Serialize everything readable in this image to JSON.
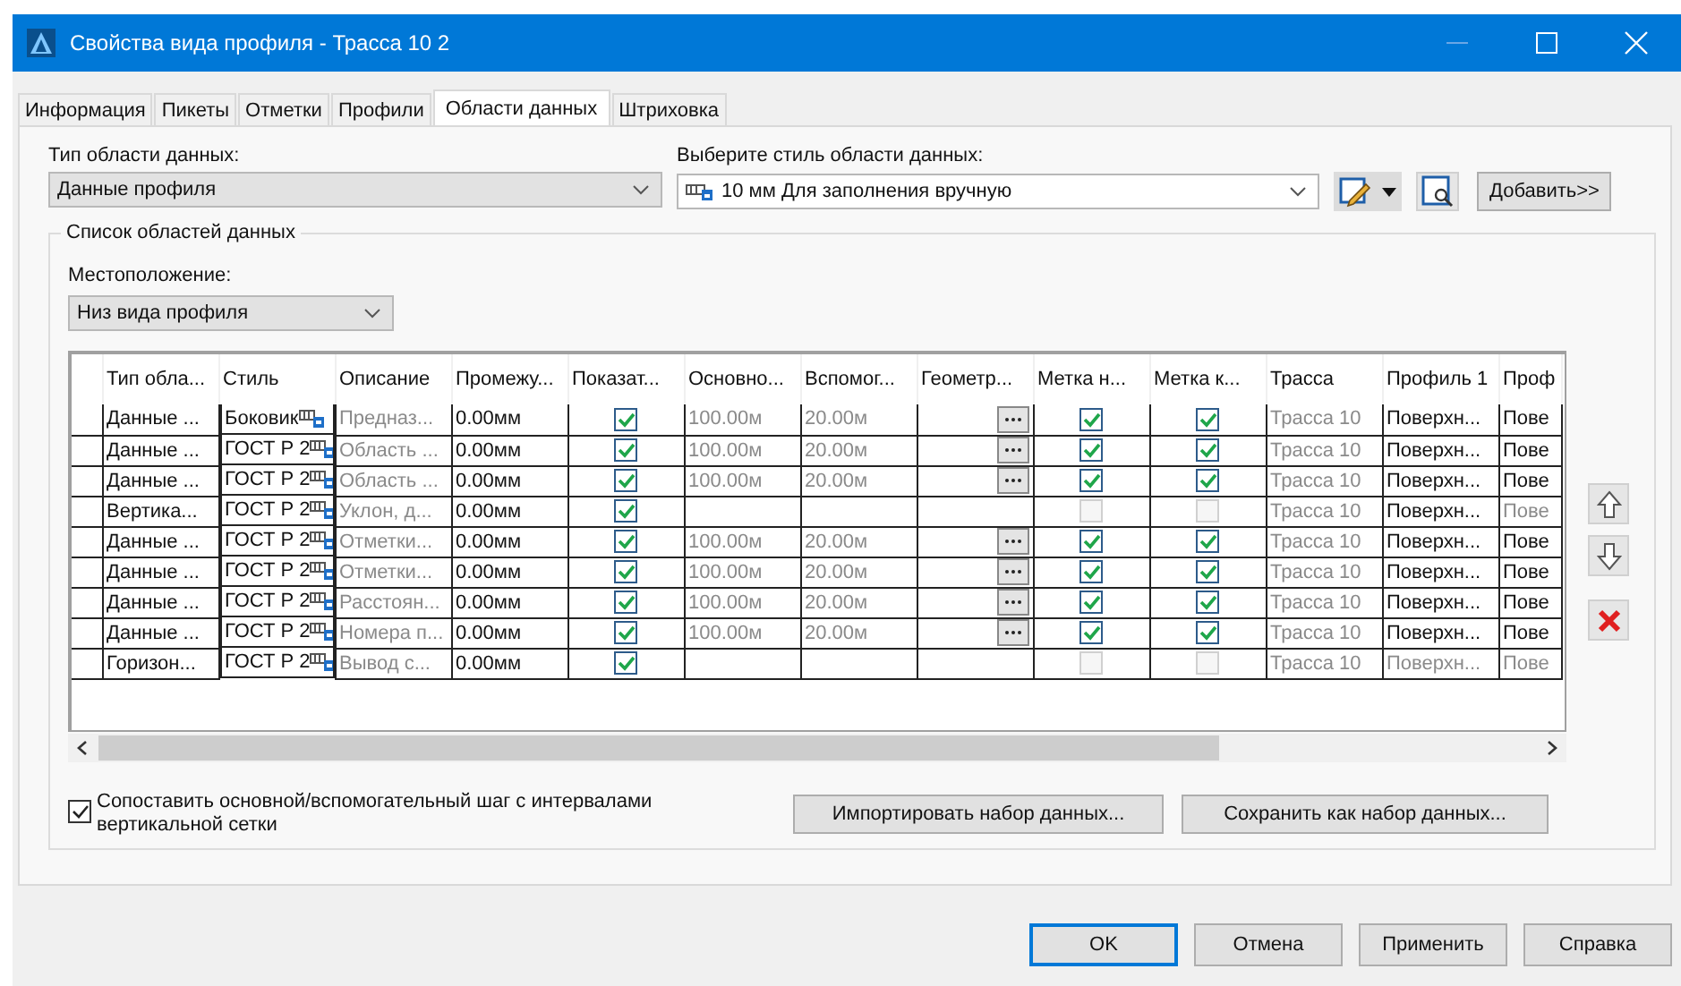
{
  "window": {
    "title": "Свойства вида профиля - Трасса 10 2"
  },
  "tabs": [
    {
      "label": "Информация",
      "selected": false
    },
    {
      "label": "Пикеты",
      "selected": false
    },
    {
      "label": "Отметки",
      "selected": false
    },
    {
      "label": "Профили",
      "selected": false
    },
    {
      "label": "Области данных",
      "selected": true
    },
    {
      "label": "Штриховка",
      "selected": false
    }
  ],
  "band_type": {
    "label": "Тип области данных:",
    "value": "Данные профиля"
  },
  "band_style": {
    "label": "Выберите стиль области данных:",
    "value": "10 мм Для заполнения вручную"
  },
  "add_button": "Добавить>>",
  "group": {
    "title": "Список областей данных",
    "location_label": "Местоположение:",
    "location_value": "Низ вида профиля"
  },
  "table": {
    "columns": [
      "Тип обла...",
      "Стиль",
      "Описание",
      "Промежу...",
      "Показат...",
      "Основно...",
      "Вспомог...",
      "Геометр...",
      "Метка н...",
      "Метка к...",
      "Трасса",
      "Профиль 1",
      "Проф"
    ],
    "rows": [
      {
        "type": "Данные ...",
        "style": "Боковик",
        "description": "Предназ...",
        "gap": "0.00мм",
        "show": true,
        "major": "100.00м",
        "minor": "20.00м",
        "geometry": true,
        "label_start": true,
        "label_end": true,
        "alignment": "Трасса 10",
        "profile1": "Поверхн...",
        "profile1_disabled": false,
        "profile2": "Пове",
        "profile2_disabled": false
      },
      {
        "type": "Данные ...",
        "style": "ГОСТ Р 2",
        "description": "Область ...",
        "gap": "0.00мм",
        "show": true,
        "major": "100.00м",
        "minor": "20.00м",
        "geometry": true,
        "label_start": true,
        "label_end": true,
        "alignment": "Трасса 10",
        "profile1": "Поверхн...",
        "profile1_disabled": false,
        "profile2": "Пове",
        "profile2_disabled": false
      },
      {
        "type": "Данные ...",
        "style": "ГОСТ Р 2",
        "description": "Область ...",
        "gap": "0.00мм",
        "show": true,
        "major": "100.00м",
        "minor": "20.00м",
        "geometry": true,
        "label_start": true,
        "label_end": true,
        "alignment": "Трасса 10",
        "profile1": "Поверхн...",
        "profile1_disabled": false,
        "profile2": "Пове",
        "profile2_disabled": false
      },
      {
        "type": "Вертика...",
        "style": "ГОСТ Р 2",
        "description": "Уклон, д...",
        "gap": "0.00мм",
        "show": true,
        "geometry": false,
        "label_start": false,
        "label_end": false,
        "alignment": "Трасса 10",
        "profile1": "Поверхн...",
        "profile1_disabled": false,
        "profile2": "Пове",
        "profile2_disabled": true
      },
      {
        "type": "Данные ...",
        "style": "ГОСТ Р 2",
        "description": "Отметки...",
        "gap": "0.00мм",
        "show": true,
        "major": "100.00м",
        "minor": "20.00м",
        "geometry": true,
        "label_start": true,
        "label_end": true,
        "alignment": "Трасса 10",
        "profile1": "Поверхн...",
        "profile1_disabled": false,
        "profile2": "Пове",
        "profile2_disabled": false
      },
      {
        "type": "Данные ...",
        "style": "ГОСТ Р 2",
        "description": "Отметки...",
        "gap": "0.00мм",
        "show": true,
        "major": "100.00м",
        "minor": "20.00м",
        "geometry": true,
        "label_start": true,
        "label_end": true,
        "alignment": "Трасса 10",
        "profile1": "Поверхн...",
        "profile1_disabled": false,
        "profile2": "Пове",
        "profile2_disabled": false
      },
      {
        "type": "Данные ...",
        "style": "ГОСТ Р 2",
        "description": "Расстоян...",
        "gap": "0.00мм",
        "show": true,
        "major": "100.00м",
        "minor": "20.00м",
        "geometry": true,
        "label_start": true,
        "label_end": true,
        "alignment": "Трасса 10",
        "profile1": "Поверхн...",
        "profile1_disabled": false,
        "profile2": "Пове",
        "profile2_disabled": false
      },
      {
        "type": "Данные ...",
        "style": "ГОСТ Р 2",
        "description": "Номера п...",
        "gap": "0.00мм",
        "show": true,
        "major": "100.00м",
        "minor": "20.00м",
        "geometry": true,
        "label_start": true,
        "label_end": true,
        "alignment": "Трасса 10",
        "profile1": "Поверхн...",
        "profile1_disabled": false,
        "profile2": "Пове",
        "profile2_disabled": false
      },
      {
        "type": "Горизон...",
        "style": "ГОСТ Р 2",
        "description": "Вывод с...",
        "gap": "0.00мм",
        "show": true,
        "geometry": false,
        "label_start": false,
        "label_end": false,
        "alignment": "Трасса 10",
        "profile1": "Поверхн...",
        "profile1_disabled": true,
        "profile2": "Пове",
        "profile2_disabled": true
      }
    ]
  },
  "match_grid": {
    "label": "Сопоставить основной/вспомогательный шаг с интервалами вертикальной сетки",
    "checked": true
  },
  "import_button": "Импортировать набор данных...",
  "save_button": "Сохранить как набор данных...",
  "buttons": [
    "OK",
    "Отмена",
    "Применить",
    "Справка"
  ]
}
